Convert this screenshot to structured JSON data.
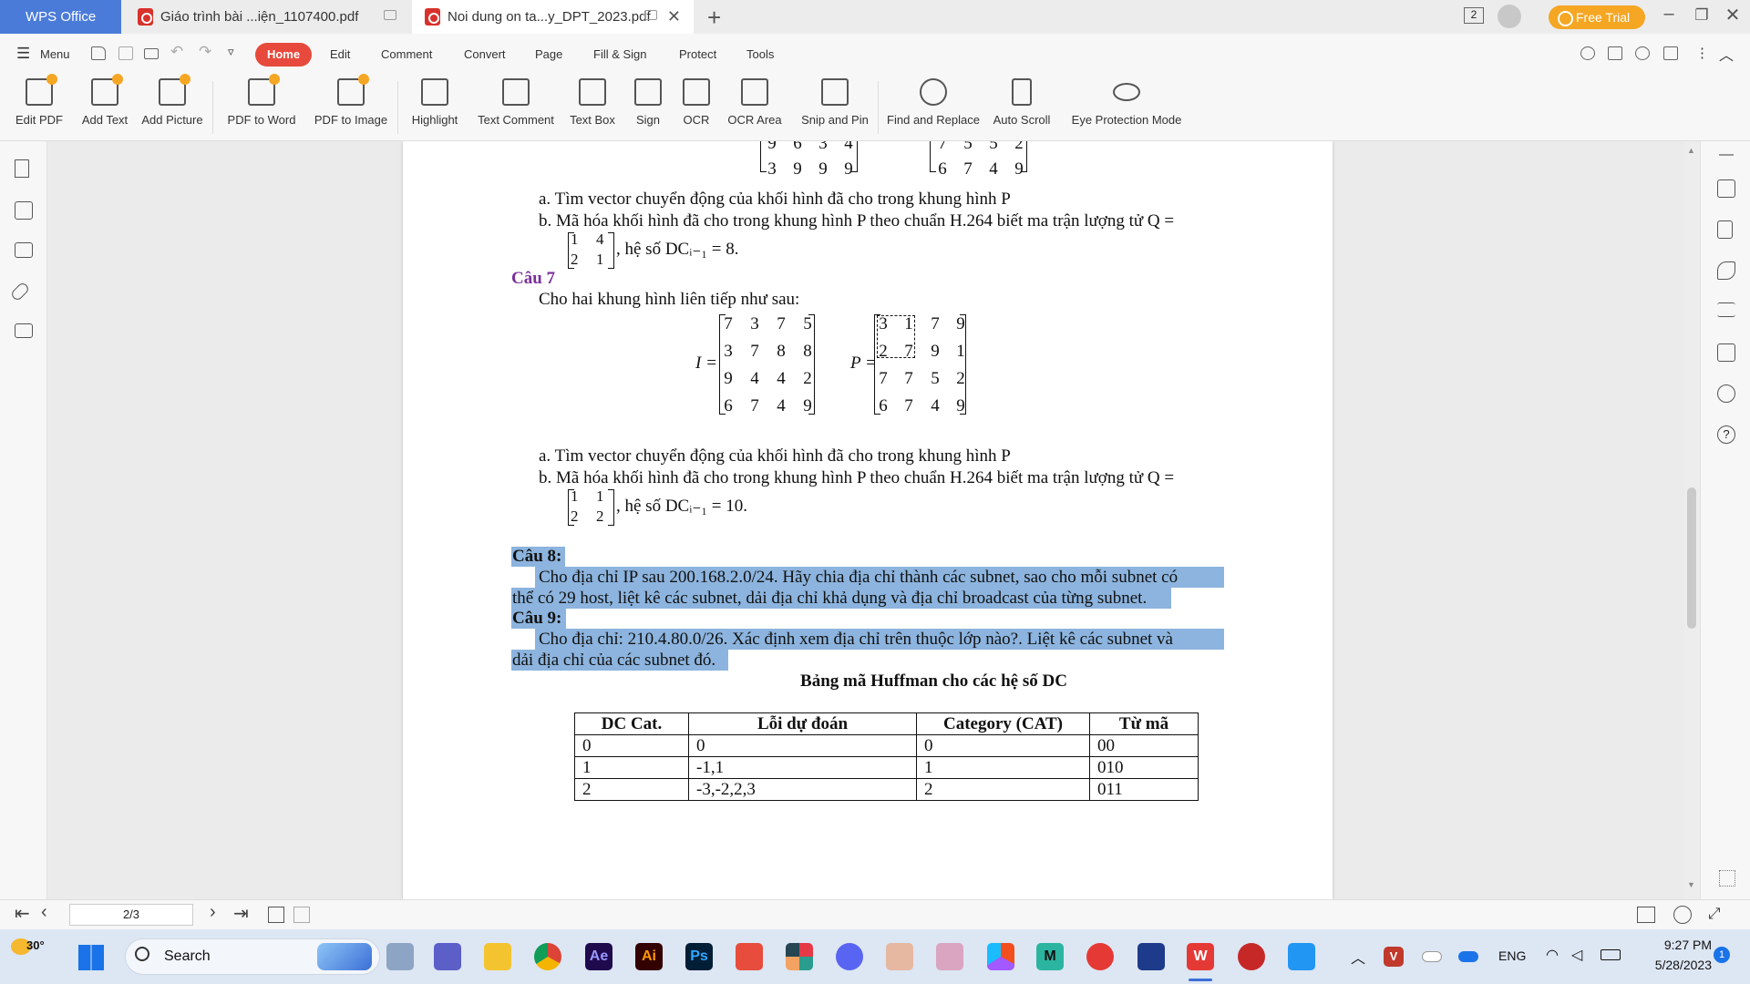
{
  "titlebar": {
    "wps_tab": "WPS Office",
    "tab1_title": "Giáo trình bài ...iện_1107400.pdf",
    "tab2_title": "Noi dung on ta...y_DPT_2023.pdf",
    "window_count": "2",
    "free_trial": "Free Trial"
  },
  "menubar": {
    "menu_label": "Menu",
    "tabs": [
      "Home",
      "Edit",
      "Comment",
      "Convert",
      "Page",
      "Fill & Sign",
      "Protect",
      "Tools"
    ]
  },
  "ribbon": {
    "edit_pdf": "Edit PDF",
    "add_text": "Add Text",
    "add_picture": "Add Picture",
    "pdf_to_word": "PDF to Word",
    "pdf_to_image": "PDF to Image",
    "highlight": "Highlight",
    "text_comment": "Text Comment",
    "text_box": "Text Box",
    "sign": "Sign",
    "ocr": "OCR",
    "ocr_area": "OCR Area",
    "snip_and_pin": "Snip and Pin",
    "find_and_replace": "Find and Replace",
    "auto_scroll": "Auto Scroll",
    "eye_protection": "Eye Protection Mode"
  },
  "document": {
    "top_matrix_left_rows": [
      [
        "9",
        "6",
        "3",
        "4"
      ],
      [
        "3",
        "9",
        "9",
        "9"
      ]
    ],
    "top_matrix_right_rows": [
      [
        "7",
        "5",
        "5",
        "2"
      ],
      [
        "6",
        "7",
        "4",
        "9"
      ]
    ],
    "q6a": "a.   Tìm vector chuyển động của khối hình đã cho trong khung hình P",
    "q6b": "b.   Mã hóa khối hình đã cho trong khung hình P theo chuẩn H.264 biết ma trận lượng tử Q =",
    "q6_q_matrix": [
      [
        "1",
        "4"
      ],
      [
        "2",
        "1"
      ]
    ],
    "q6_dc": ", hệ số DCᵢ₋₁ = 8.",
    "cau7_title": "Câu 7",
    "cau7_intro": "Cho hai khung hình liên tiếp như sau:",
    "i_label": "I =",
    "p_label": "P =",
    "i_matrix": [
      [
        "7",
        "3",
        "7",
        "5"
      ],
      [
        "3",
        "7",
        "8",
        "8"
      ],
      [
        "9",
        "4",
        "4",
        "2"
      ],
      [
        "6",
        "7",
        "4",
        "9"
      ]
    ],
    "p_matrix": [
      [
        "3",
        "1",
        "7",
        "9"
      ],
      [
        "2",
        "7",
        "9",
        "1"
      ],
      [
        "7",
        "7",
        "5",
        "2"
      ],
      [
        "6",
        "7",
        "4",
        "9"
      ]
    ],
    "q7a": "a.   Tìm vector chuyển động của khối hình đã cho trong khung hình P",
    "q7b": "b.   Mã hóa khối hình đã cho trong khung hình P theo chuẩn H.264 biết ma trận lượng tử Q =",
    "q7_q_matrix": [
      [
        "1",
        "1"
      ],
      [
        "2",
        "2"
      ]
    ],
    "q7_dc": ", hệ số DCᵢ₋₁ = 10.",
    "cau8_title": "Câu 8:",
    "cau8_line1": "Cho địa chỉ IP sau 200.168.2.0/24. Hãy chia địa chỉ thành các subnet, sao cho mỗi subnet có",
    "cau8_line2": "thể có 29 host, liệt kê các subnet, dải địa chỉ khả dụng và địa chỉ broadcast của từng subnet.",
    "cau9_title": "Câu 9:",
    "cau9_line1": "Cho địa chỉ: 210.4.80.0/26. Xác định xem địa chỉ trên thuộc lớp nào?. Liệt kê các subnet và",
    "cau9_line2": "dải địa chỉ của các subnet đó.",
    "table_title": "Bảng mã Huffman cho các hệ số DC",
    "table_headers": [
      "DC Cat.",
      "Lỗi dự đoán",
      "Category (CAT)",
      "Từ mã"
    ],
    "table_rows": [
      [
        "0",
        "0",
        "0",
        "00"
      ],
      [
        "1",
        "-1,1",
        "1",
        "010"
      ],
      [
        "2",
        "-3,-2,2,3",
        "2",
        "011"
      ]
    ]
  },
  "statusbar": {
    "page_indicator": "2/3"
  },
  "taskbar": {
    "weather_temp": "30°",
    "search_label": "Search",
    "apps": [
      "Ae",
      "Ai",
      "Ps"
    ],
    "lang": "ENG",
    "time": "9:27 PM",
    "date": "5/28/2023",
    "notification_count": "1"
  },
  "colors": {
    "home_tab": "#e74a3c",
    "wps_tab": "#4b7bd9",
    "selection_highlight": "#8cb4de",
    "heading_purple": "#7a2f9a",
    "free_trial": "#f5a623"
  }
}
